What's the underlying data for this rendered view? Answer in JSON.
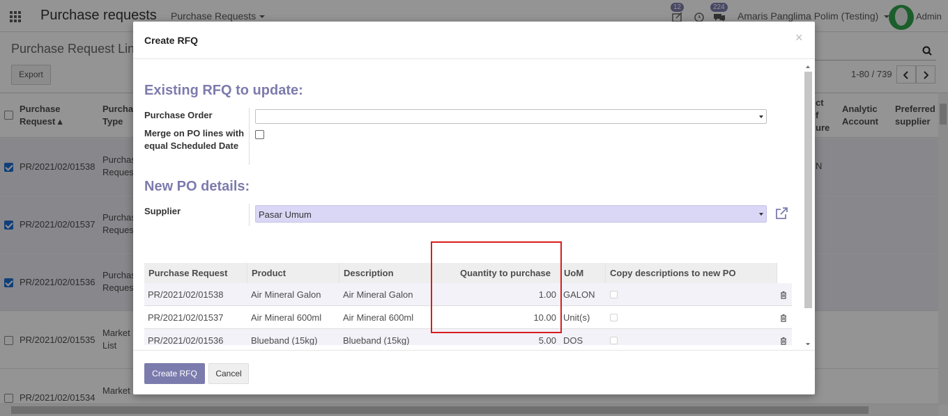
{
  "navbar": {
    "app_title": "Purchase requests",
    "menu": "Purchase Requests",
    "activity_badge": "12",
    "messages_badge": "224",
    "company": "Amaris Panglima Polim (Testing)",
    "user": "Admin"
  },
  "control_panel": {
    "breadcrumb": "Purchase Request Lin",
    "export_label": "Export",
    "pager": "1-80 / 739"
  },
  "list": {
    "headers": {
      "purchase_request": "Purchase Request",
      "purchase_type": "Purcha Type",
      "product_of_measure": "ct f ure",
      "analytic_account": "Analytic Account",
      "preferred_supplier": "Preferred supplier"
    },
    "rows": [
      {
        "ref": "PR/2021/02/01538",
        "type": "Purchas Reques",
        "tail": "N",
        "selected": true
      },
      {
        "ref": "PR/2021/02/01537",
        "type": "Purchas Reques",
        "tail": "",
        "selected": true
      },
      {
        "ref": "PR/2021/02/01536",
        "type": "Purchas Reques",
        "tail": "",
        "selected": true
      },
      {
        "ref": "PR/2021/02/01535",
        "type": "Market List",
        "tail": "",
        "selected": false
      },
      {
        "ref": "PR/2021/02/01534",
        "type": "Market",
        "tail": "",
        "selected": false
      }
    ]
  },
  "modal": {
    "title": "Create RFQ",
    "close": "×",
    "existing_section": "Existing RFQ to update:",
    "purchase_order_label": "Purchase Order",
    "purchase_order_value": "",
    "merge_label": "Merge on PO lines with equal Scheduled Date",
    "new_section": "New PO details:",
    "supplier_label": "Supplier",
    "supplier_value": "Pasar Umum",
    "table": {
      "headers": [
        "Purchase Request",
        "Product",
        "Description",
        "Quantity to purchase",
        "UoM",
        "Copy descriptions to new PO"
      ],
      "rows": [
        {
          "request": "PR/2021/02/01538",
          "product": "Air Mineral Galon",
          "description": "Air Mineral Galon",
          "qty": "1.00",
          "uom": "GALON"
        },
        {
          "request": "PR/2021/02/01537",
          "product": "Air Mineral 600ml",
          "description": "Air Mineral 600ml",
          "qty": "10.00",
          "uom": "Unit(s)"
        },
        {
          "request": "PR/2021/02/01536",
          "product": "Blueband (15kg)",
          "description": "Blueband (15kg)",
          "qty": "5.00",
          "uom": "DOS"
        }
      ]
    },
    "create_label": "Create RFQ",
    "cancel_label": "Cancel"
  },
  "colors": {
    "accent": "#7c7bad",
    "highlight": "#d81c1c",
    "supplier_field": "#d9d7f5"
  }
}
